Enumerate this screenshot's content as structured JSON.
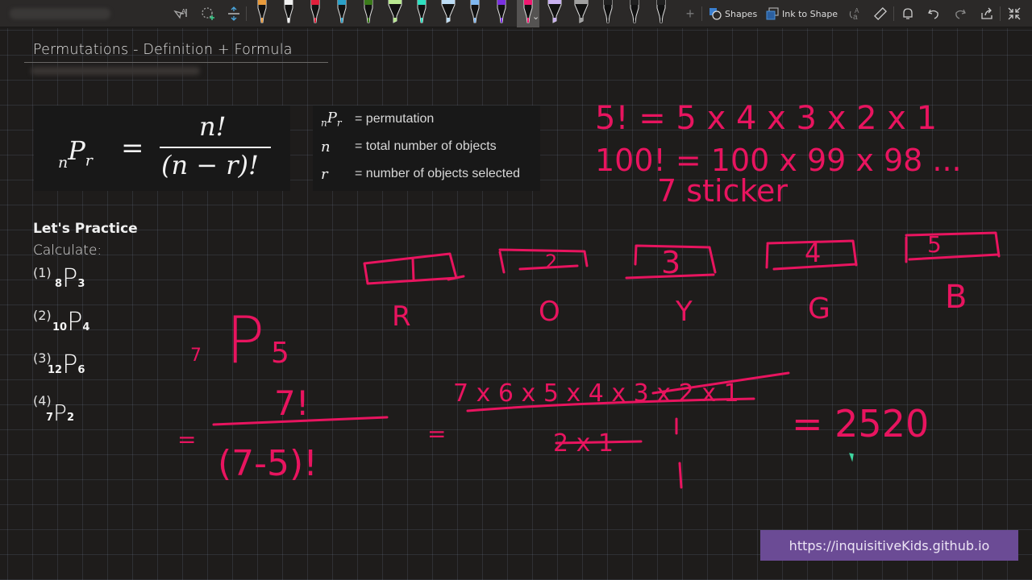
{
  "toolbar": {
    "tools": [
      {
        "name": "lasso-text-select",
        "icon": "lasso-text-icon"
      },
      {
        "name": "lasso-add",
        "icon": "lasso-add-icon"
      },
      {
        "name": "insert-space",
        "icon": "insert-space-icon"
      }
    ],
    "pens": [
      {
        "color": "#e89a3c",
        "type": "pen"
      },
      {
        "color": "#f0f0f0",
        "type": "pen"
      },
      {
        "color": "#e0203c",
        "type": "pen"
      },
      {
        "color": "#2aa0c8",
        "type": "pen"
      },
      {
        "color": "#3a7a1a",
        "type": "pen"
      },
      {
        "color": "#b8e890",
        "type": "highlighter"
      },
      {
        "color": "#2ee0c0",
        "type": "pen"
      },
      {
        "color": "#bcdcf4",
        "type": "highlighter"
      },
      {
        "color": "#80b8f0",
        "type": "pen"
      },
      {
        "color": "#7a30e0",
        "type": "pen"
      },
      {
        "color": "#f01870",
        "type": "pen",
        "selected": true
      },
      {
        "color": "#c8b0f0",
        "type": "highlighter"
      },
      {
        "color": "#a0a0a0",
        "type": "highlighter"
      },
      {
        "color": "#202020",
        "type": "pen"
      },
      {
        "color": "#202020",
        "type": "pen"
      },
      {
        "color": "#202020",
        "type": "pen"
      }
    ],
    "add_pen_label": "+",
    "shapes_label": "Shapes",
    "ink_to_shape_label": "Ink to Shape",
    "right_icons": [
      "ink-to-text-icon",
      "ruler-icon",
      "bell-icon",
      "undo-icon",
      "redo-icon",
      "share-icon",
      "collapse-icon"
    ]
  },
  "page": {
    "title": "Permutations - Definition + Formula",
    "formula": {
      "lhs_pre": "n",
      "lhs_main": "P",
      "lhs_sub": "r",
      "equals": "=",
      "numerator": "n!",
      "denominator": "(n − r)!"
    },
    "legend": [
      {
        "symbol_pre": "n",
        "symbol": "P",
        "symbol_sub": "r",
        "text": "= permutation"
      },
      {
        "symbol": "n",
        "text": "= total number of objects"
      },
      {
        "symbol": "r",
        "text": "= number of objects selected"
      }
    ],
    "practice": {
      "title": "Let's Practice",
      "subtitle": "Calculate:",
      "items": [
        {
          "label": "(1)",
          "n": "8",
          "r": "3"
        },
        {
          "label": "(2)",
          "n": "10",
          "r": "4"
        },
        {
          "label": "(3)",
          "n": "12",
          "r": "6"
        },
        {
          "label": "(4)",
          "n": "7",
          "r": "2"
        }
      ]
    }
  },
  "ink_notes": {
    "factorial_line_1": "5! = 5 x 4 x 3 x 2 x 1",
    "factorial_line_2": "100! = 100 x 99 x 98 ...",
    "sticker_note": "7 sticker",
    "slots": [
      {
        "number": "1",
        "letter": "R"
      },
      {
        "number": "2",
        "letter": "O"
      },
      {
        "number": "3",
        "letter": "Y"
      },
      {
        "number": "4",
        "letter": "G"
      },
      {
        "number": "5",
        "letter": "B"
      }
    ],
    "problem_n": "7",
    "problem_r": "5",
    "fraction_num": "7!",
    "fraction_den": "(7-5)!",
    "expanded_num": "7 x 6 x 5 x 4 x 3 x 2 x 1",
    "expanded_den": "2 x 1",
    "result": "= 2520",
    "ink_color": "#e8145f"
  },
  "footer": {
    "link_text": "https://inquisitiveKids.github.io",
    "badge_color": "#6b4b95"
  }
}
